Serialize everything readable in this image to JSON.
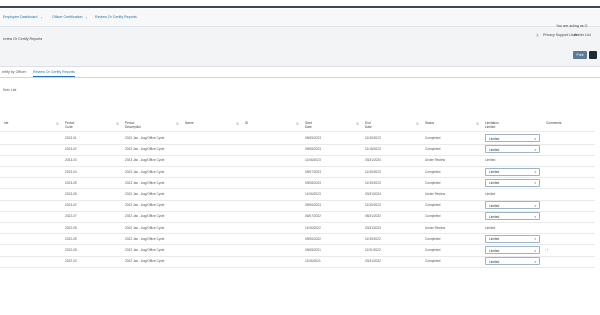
{
  "breadcrumb": [
    "Employee Dashboard",
    "Officer Certification",
    "Review Or Certify Reports"
  ],
  "header": {
    "you_are_acting": "You are acting as O",
    "title": "eview Or Certify Reports",
    "privacy_label": "Privacy Support User",
    "admin_label": "Admin Lisl",
    "print_label": "Print"
  },
  "tabs": [
    "ertify by Officer",
    "Review Or Certify Reports"
  ],
  "filter_label": "ficer List",
  "columns": [
    "Ide",
    "Period Code",
    "Period Description",
    "Name",
    "ID",
    "Start Date",
    "End Date",
    "Status",
    "Limitation Limited",
    "Comments"
  ],
  "rows": [
    {
      "code": "2023-01",
      "desc": "2023 Jan - Aug/Office Cycle",
      "start": "09/05/2023",
      "end": "11/30/2023",
      "status": "Completed",
      "limited": "Limited",
      "has_select": true,
      "comment_icon": false
    },
    {
      "code": "2023-02",
      "desc": "2023 Jan - Aug/Office Cycle",
      "start": "09/08/2023",
      "end": "11/16/2023",
      "status": "Completed",
      "limited": "Limited",
      "has_select": true,
      "comment_icon": false
    },
    {
      "code": "2023-03",
      "desc": "2023 Jan - Aug/Office Cycle",
      "start": "11/06/2023",
      "end": "03/31/2024",
      "status": "Under Review",
      "limited": "Limited",
      "has_select": false,
      "comment_icon": false
    },
    {
      "code": "2023-04",
      "desc": "2023 Jan - Aug/Office Cycle",
      "start": "09/07/2023",
      "end": "11/30/2023",
      "status": "Completed",
      "limited": "Limited",
      "has_select": true,
      "comment_icon": false
    },
    {
      "code": "2023-05",
      "desc": "2023 Jan - Aug/Office Cycle",
      "start": "09/08/2023",
      "end": "11/30/2023",
      "status": "Completed",
      "limited": "Limited",
      "has_select": true,
      "comment_icon": false
    },
    {
      "code": "2023-06",
      "desc": "2023 Jan - Aug/Office Cycle",
      "start": "11/06/2023",
      "end": "03/31/2024",
      "status": "Under Review",
      "limited": "Limited",
      "has_select": false,
      "comment_icon": false
    },
    {
      "code": "2023-02",
      "desc": "2023 Jan - Aug/Office Cycle",
      "start": "09/06/2023",
      "end": "11/30/2023",
      "status": "Completed",
      "limited": "Limited",
      "has_select": true,
      "comment_icon": false
    },
    {
      "code": "2022-07",
      "desc": "2022 Jan - Aug/Office Cycle",
      "start": "06/07/2022",
      "end": "08/31/2022",
      "status": "Completed",
      "limited": "Limited",
      "has_select": true,
      "comment_icon": false
    },
    {
      "code": "2022-05",
      "desc": "2022 Jan - Aug/Office Cycle",
      "start": "11/06/2022",
      "end": "03/31/2023",
      "status": "Under Review",
      "limited": "Limited",
      "has_select": false,
      "comment_icon": false
    },
    {
      "code": "2022-05",
      "desc": "2022 Jan - Aug/Office Cycle",
      "start": "09/06/2022",
      "end": "11/30/2022",
      "status": "Completed",
      "limited": "Limited",
      "has_select": true,
      "comment_icon": false
    },
    {
      "code": "2022-05",
      "desc": "2022 Jan - Aug/Office Cycle",
      "start": "09/08/2021",
      "end": "11/31/2022",
      "status": "Completed",
      "limited": "Limited",
      "has_select": true,
      "comment_icon": true
    },
    {
      "code": "2022-03",
      "desc": "2022 Jan - Aug/Office Cycle",
      "start": "11/06/2021",
      "end": "03/31/2022",
      "status": "Completed",
      "limited": "Limited",
      "has_select": true,
      "comment_icon": false
    }
  ],
  "colors": {
    "accent": "#1f6fb2",
    "header_bar": "#3a4a57",
    "print_button": "#5a7a98"
  }
}
